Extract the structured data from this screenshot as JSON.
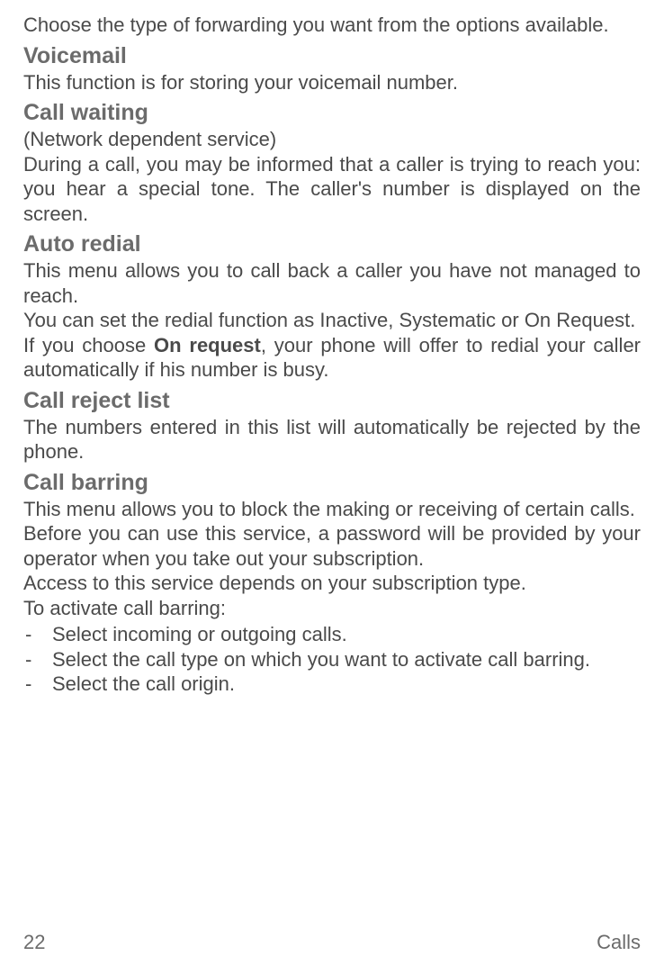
{
  "intro": "Choose the type of forwarding you want from the options available.",
  "sections": {
    "voicemail": {
      "heading": "Voicemail",
      "p1": "This function is for storing your voicemail number."
    },
    "callWaiting": {
      "heading": "Call waiting",
      "p1": "(Network dependent service)",
      "p2": "During a call, you may be informed that a caller is trying to reach you: you hear a special tone. The caller's number is displayed on the screen."
    },
    "autoRedial": {
      "heading": "Auto redial",
      "p1": "This menu allows you to call back a caller you have not managed to reach.",
      "p2": "You can set the redial function as Inactive, Systematic or On Request.",
      "p3a": "If you choose ",
      "p3bold": "On request",
      "p3b": ", your phone will offer to redial your caller automatically if his number is busy."
    },
    "callRejectList": {
      "heading": "Call reject list",
      "p1": "The numbers entered in this list will automatically be rejected by the phone."
    },
    "callBarring": {
      "heading": "Call barring",
      "p1": "This menu allows you to block the making or receiving of certain calls.",
      "p2": "Before you can use this service, a password will be provided by your operator when you take out your subscription.",
      "p3": "Access to this service depends on your subscription type.",
      "p4": "To activate call barring:",
      "li1": "Select incoming or outgoing calls.",
      "li2": "Select the call type on which you want to activate call barring.",
      "li3": "Select the call origin."
    }
  },
  "footer": {
    "pageNumber": "22",
    "sectionLabel": "Calls"
  }
}
